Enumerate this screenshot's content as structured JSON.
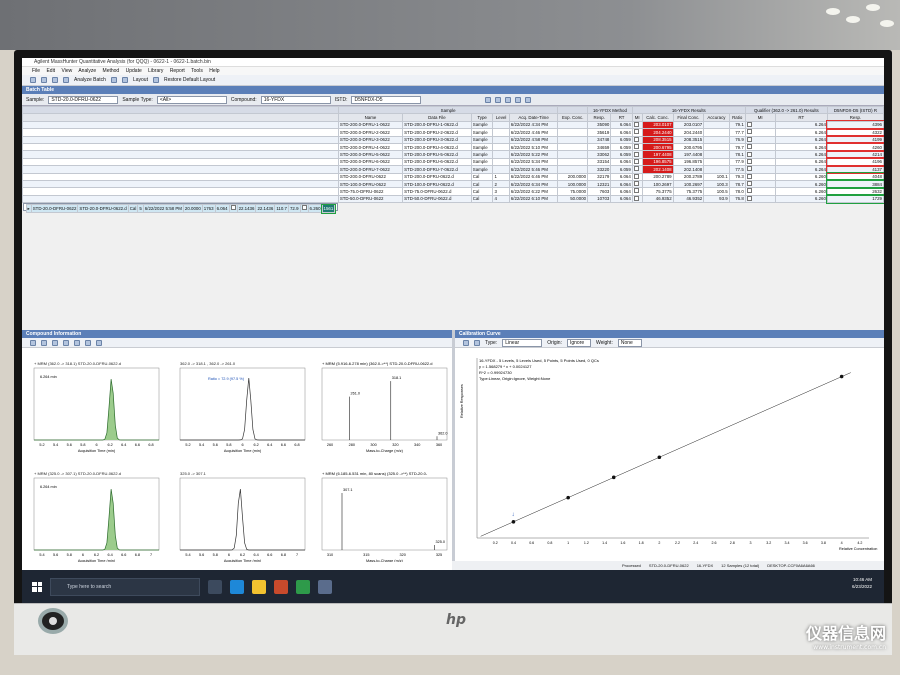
{
  "window": {
    "title": "Agilent MassHunter Quantitative Analysis (for QQQ) - 0622-1 - 0622-1.batch.bin"
  },
  "menu": [
    "File",
    "Edit",
    "View",
    "Analyze",
    "Method",
    "Update",
    "Library",
    "Report",
    "Tools",
    "Help"
  ],
  "toolbar": {
    "analyze": "Analyze Batch",
    "layout": "Layout",
    "restore": "Restore Default Layout"
  },
  "batch": {
    "panel_title": "Batch Table",
    "filters": {
      "sample_label": "Sample:",
      "sample_value": "STD-20.0-DFRU-0622",
      "type_label": "Sample Type:",
      "type_value": "<All>",
      "compound_label": "Compound:",
      "compound_value": "16-YFDX",
      "istd_label": "ISTD:",
      "istd_value": "D5NFDX-D5"
    },
    "groups": {
      "sample": "Sample",
      "method": "16-YFDX Method",
      "results": "16-YFDX Results",
      "qualifier": "Qualifier (362.0 -> 261.0) Results",
      "istd": "D5NFDX-D5 (ISTD) R"
    },
    "headers": [
      "Name",
      "Data File",
      "Type",
      "Level",
      "Acq. Date-Time",
      "Exp. Conc.",
      "Resp.",
      "RT",
      "MI",
      "Calc. Conc.",
      "Final Conc.",
      "Accuracy",
      "Ratio",
      "MI",
      "RT",
      "Resp."
    ],
    "rows": [
      {
        "name": "STD-200.0-DFRU-1-0622",
        "file": "STD-200.0-DFRU-1-0622.d",
        "type": "Sample",
        "level": "",
        "date": "6/22/2022 4:34 PM",
        "exp": "",
        "resp": "35090",
        "rt": "6.064",
        "calc": "203.0107",
        "final": "203.0107",
        "acc": "",
        "ratio": "79.1",
        "irt": "6.264",
        "iresp": "4396"
      },
      {
        "name": "STD-200.0-DFRU-2-0622",
        "file": "STD-200.0-DFRU-2-0622.d",
        "type": "Sample",
        "level": "",
        "date": "6/22/2022 4:46 PM",
        "exp": "",
        "resp": "35619",
        "rt": "6.064",
        "calc": "204.2440",
        "final": "204.2440",
        "acc": "",
        "ratio": "77.7",
        "irt": "6.264",
        "iresp": "4322"
      },
      {
        "name": "STD-200.0-DFRU-3-0622",
        "file": "STD-200.0-DFRU-3-0622.d",
        "type": "Sample",
        "level": "",
        "date": "6/22/2022 4:58 PM",
        "exp": "",
        "resp": "34748",
        "rt": "6.059",
        "calc": "208.3515",
        "final": "208.3515",
        "acc": "",
        "ratio": "76.9",
        "irt": "6.264",
        "iresp": "4199"
      },
      {
        "name": "STD-200.0-DFRU-4-0622",
        "file": "STD-200.0-DFRU-4-0622.d",
        "type": "Sample",
        "level": "",
        "date": "6/22/2022 5:10 PM",
        "exp": "",
        "resp": "34659",
        "rt": "6.059",
        "calc": "200.6795",
        "final": "200.6795",
        "acc": "",
        "ratio": "79.7",
        "irt": "6.264",
        "iresp": "4260"
      },
      {
        "name": "STD-200.0-DFRU-5-0622",
        "file": "STD-200.0-DFRU-5-0622.d",
        "type": "Sample",
        "level": "",
        "date": "6/22/2022 5:22 PM",
        "exp": "",
        "resp": "33062",
        "rt": "6.059",
        "calc": "197.4408",
        "final": "197.4408",
        "acc": "",
        "ratio": "78.1",
        "irt": "6.264",
        "iresp": "4214"
      },
      {
        "name": "STD-200.0-DFRU-6-0622",
        "file": "STD-200.0-DFRU-6-0622.d",
        "type": "Sample",
        "level": "",
        "date": "6/22/2022 5:34 PM",
        "exp": "",
        "resp": "33154",
        "rt": "6.064",
        "calc": "196.8575",
        "final": "196.8575",
        "acc": "",
        "ratio": "77.9",
        "irt": "6.264",
        "iresp": "4196"
      },
      {
        "name": "STD-200.0-DFRU-7-0622",
        "file": "STD-200.0-DFRU-7-0622.d",
        "type": "Sample",
        "level": "",
        "date": "6/22/2022 5:46 PM",
        "exp": "",
        "resp": "33220",
        "rt": "6.059",
        "calc": "202.1408",
        "final": "202.1408",
        "acc": "",
        "ratio": "77.5",
        "irt": "6.264",
        "iresp": "4137"
      },
      {
        "name": "STD-200.0-DFRU-0622",
        "file": "STD-200.0-DFRU-0622.d",
        "type": "Cal",
        "level": "1",
        "date": "6/22/2022 6:46 PM",
        "exp": "200.0000",
        "resp": "32179",
        "rt": "6.064",
        "calc": "200.2789",
        "final": "200.2789",
        "acc": "100.1",
        "ratio": "79.3",
        "irt": "6.260",
        "iresp": "4048"
      },
      {
        "name": "STD-100.0-DFRU-0622",
        "file": "STD-100.0-DFRU-0622.d",
        "type": "Cal",
        "level": "2",
        "date": "6/22/2022 6:34 PM",
        "exp": "100.0000",
        "resp": "12321",
        "rt": "6.064",
        "calc": "100.2697",
        "final": "100.2697",
        "acc": "100.3",
        "ratio": "78.7",
        "irt": "6.260",
        "iresp": "3884"
      },
      {
        "name": "STD-75.0-DFRU-0622",
        "file": "STD-75.0-DFRU-0622.d",
        "type": "Cal",
        "level": "3",
        "date": "6/22/2022 6:22 PM",
        "exp": "75.0000",
        "resp": "7603",
        "rt": "6.064",
        "calc": "75.3775",
        "final": "75.3775",
        "acc": "100.5",
        "ratio": "78.0",
        "irt": "6.260",
        "iresp": "2632"
      },
      {
        "name": "STD-50.0-DFRU-0622",
        "file": "STD-50.0-DFRU-0622.d",
        "type": "Cal",
        "level": "4",
        "date": "6/22/2022 6:10 PM",
        "exp": "50.0000",
        "resp": "10703",
        "rt": "6.064",
        "calc": "46.9352",
        "final": "46.9352",
        "acc": "93.9",
        "ratio": "76.8",
        "irt": "6.260",
        "iresp": "1729"
      },
      {
        "name": "STD-20.0-DFRU-0622",
        "file": "STD-20.0-DFRU-0622.d",
        "type": "Cal",
        "level": "5",
        "date": "6/22/2022 5:58 PM",
        "exp": "20.0000",
        "resp": "1763",
        "rt": "6.064",
        "calc": "22.1436",
        "final": "22.1436",
        "acc": "110.7",
        "ratio": "72.9",
        "irt": "6.260",
        "iresp": "1561"
      }
    ]
  },
  "compound": {
    "panel_title": "Compound Information",
    "p1": {
      "title": "+ MRM (362.0 -> 318.1) STD-20.0-DFRU-0622.d",
      "rt": "6.264 min",
      "xlabel": "Acquisition Time (min)",
      "ticks": [
        "5.2",
        "5.4",
        "5.6",
        "5.8",
        "6",
        "6.2",
        "6.4",
        "6.6",
        "6.8"
      ],
      "scale": "x10^1"
    },
    "p2": {
      "title": "362.0 -> 318.1 , 362.0 -> 261.0",
      "ratio": "Ratio = 72.9 (97.5 %)",
      "xlabel": "Acquisition Time (min)",
      "ylabel": "Relative Abundance (%)",
      "ticks": [
        "5.2",
        "5.4",
        "5.6",
        "5.8",
        "6",
        "6.2",
        "6.4",
        "6.6",
        "6.8"
      ]
    },
    "p3": {
      "title": "+ MRM (5.916-6.278 min) (362.0->**) STD-20.0-DFRU-0622.d",
      "scale": "x10^1",
      "xlabel": "Mass-to-Charge (m/z)",
      "peaks": [
        "261.0",
        "318.1",
        "362.0"
      ],
      "ticks": [
        "260",
        "280",
        "300",
        "320",
        "340",
        "360"
      ]
    },
    "p4": {
      "title": "+ MRM (325.0 -> 307.1) STD-20.0-DFRU-0622.d",
      "rt": "6.264 min",
      "xlabel": "Acquisition Time (min)",
      "ticks": [
        "5.4",
        "5.6",
        "5.8",
        "6",
        "6.2",
        "6.4",
        "6.6",
        "6.8",
        "7"
      ]
    },
    "p5": {
      "title": "325.0 -> 307.1",
      "xlabel": "Acquisition Time (min)",
      "ylabel": "Relative Abundance (%)",
      "ticks": [
        "5.4",
        "5.6",
        "5.8",
        "6",
        "6.2",
        "6.4",
        "6.6",
        "6.8",
        "7"
      ]
    },
    "p6": {
      "title": "+ MRM (6.185-6.531 min, 80 scans) (325.0 ->**) STD-20.0-",
      "xlabel": "Mass-to-Charge (m/z)",
      "peaks": [
        "307.1",
        "325.0"
      ],
      "ticks": [
        "310",
        "315",
        "320",
        "325"
      ]
    }
  },
  "calibration": {
    "panel_title": "Calibration Curve",
    "type_label": "Type:",
    "type_value": "Linear",
    "origin_label": "Origin:",
    "origin_value": "Ignore",
    "weight_label": "Weight:",
    "weight_value": "None",
    "eq_title": "16-YFDX - 5 Levels, 5 Levels Used, 5 Points, 5 Points Used, 0 QCs",
    "equation": "y = 1.568279 * x + 0.0024127",
    "r2": "R^2 = 0.99924730",
    "fit": "Type:Linear, Origin:Ignore, Weight:None",
    "xlabel": "Relative Concentration",
    "ylabel": "Relative Responses",
    "x_ticks": [
      "0.2",
      "0.4",
      "0.6",
      "0.8",
      "1",
      "1.2",
      "1.4",
      "1.6",
      "1.8",
      "2",
      "2.2",
      "2.4",
      "2.6",
      "2.8",
      "3",
      "3.2",
      "3.4",
      "3.6",
      "3.8",
      "4",
      "4.2"
    ]
  },
  "status": {
    "state": "Processed",
    "sample": "STD-20.0-DFRU-0622",
    "compound": "16-YFDX",
    "count": "12 Samples (12 total)",
    "user": "DESKTOP-CCF0A6A6A66"
  },
  "taskbar": {
    "search_placeholder": "Type here to search",
    "time": "10:46 AM",
    "date": "6/23/2022"
  },
  "watermark": {
    "brand": "仪器信息网",
    "url": "www.instrument.com.cn"
  },
  "chart_data": {
    "type": "scatter",
    "title": "16-YFDX - 5 Levels, 5 Levels Used, 5 Points, 5 Points Used, 0 QCs",
    "xlabel": "Relative Concentration",
    "ylabel": "Relative Responses",
    "xlim": [
      0,
      4.3
    ],
    "ylim": [
      0,
      7
    ],
    "series": [
      {
        "x": [
          0.4,
          1.0,
          1.5,
          2.0,
          4.0
        ],
        "y": [
          0.63,
          1.57,
          2.36,
          3.14,
          6.28
        ]
      }
    ],
    "fit": {
      "slope": 1.568279,
      "intercept": 0.0024127
    }
  }
}
